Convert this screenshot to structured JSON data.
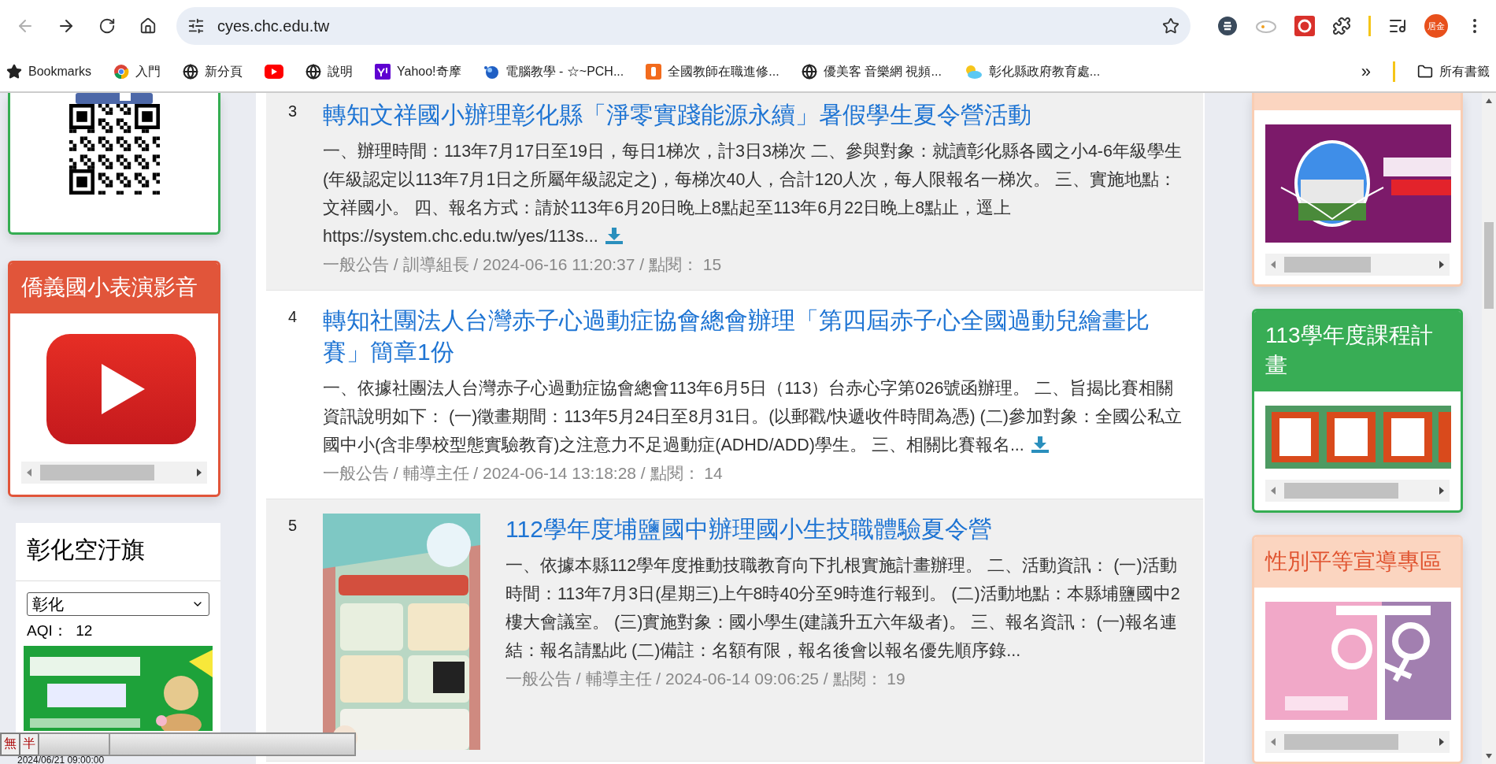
{
  "browser": {
    "address": "cyes.chc.edu.tw",
    "back_disabled": true,
    "avatar": "居金",
    "bookmarks": [
      {
        "kind": "star",
        "label": "Bookmarks"
      },
      {
        "kind": "chrome",
        "label": "入門"
      },
      {
        "kind": "globe",
        "label": "新分頁"
      },
      {
        "kind": "youtube"
      },
      {
        "kind": "globe",
        "label": "說明"
      },
      {
        "kind": "yahoo",
        "label": "Yahoo!奇摩"
      },
      {
        "kind": "orb",
        "label": "電腦教學 - ☆~PCH..."
      },
      {
        "kind": "app",
        "label": "全國教師在職進修..."
      },
      {
        "kind": "globe",
        "label": "優美客 音樂網 視頻..."
      },
      {
        "kind": "weather",
        "label": "彰化縣政府教育處..."
      }
    ],
    "overflow": "»",
    "all_bookmarks": "所有書籤"
  },
  "left": {
    "video_card": {
      "title": "僑義國小表演影音"
    },
    "air_card": {
      "title": "彰化空汙旗",
      "select_value": "彰化",
      "aqi_label": "AQI：",
      "aqi_value": "12"
    }
  },
  "notices": [
    {
      "kind": "text",
      "number": "3",
      "title": "轉知文祥國小辦理彰化縣「淨零實踐能源永續」暑假學生夏令營活動",
      "body": "一、辦理時間：113年7月17日至19日，每日1梯次，計3日3梯次 二、參與對象：就讀彰化縣各國之小4-6年級學生(年級認定以113年7月1日之所屬年級認定之)，每梯次40人，合計120人次，每人限報名一梯次。 三、實施地點：文祥國小。 四、報名方式：請於113年6月20日晚上8點起至113年6月22日晚上8點止，逕上https://system.chc.edu.tw/yes/113s...",
      "download": true,
      "meta": "一般公告 / 訓導組長 / 2024-06-16 11:20:37 / 點閱： 15"
    },
    {
      "kind": "text",
      "number": "4",
      "title": "轉知社團法人台灣赤子心過動症協會總會辦理「第四屆赤子心全國過動兒繪畫比賽」簡章1份",
      "body": "一、依據社團法人台灣赤子心過動症協會總會113年6月5日（113）台赤心字第026號函辦理。 二、旨揭比賽相關資訊說明如下： (一)徵畫期間：113年5月24日至8月31日。(以郵戳/快遞收件時間為憑) (二)參加對象：全國公私立國中小(含非學校型態實驗教育)之注意力不足過動症(ADHD/ADD)學生。 三、相關比賽報名...",
      "download": true,
      "meta": "一般公告 / 輔導主任 / 2024-06-14 13:18:28 / 點閱： 14"
    },
    {
      "kind": "picture",
      "number": "5",
      "title": "112學年度埔鹽國中辦理國小生技職體驗夏令營",
      "body": "一、依據本縣112學年度推動技職教育向下扎根實施計畫辦理。 二、活動資訊： (一)活動時間：113年7月3日(星期三)上午8時40分至9時進行報到。 (二)活動地點：本縣埔鹽國中2樓大會議室。 (三)實施對象：國小學生(建議升五六年級者)。 三、報名資訊： (一)報名連結：報名請點此 (二)備註：名額有限，報名後會以報名優先順序錄...",
      "download": false,
      "meta": "一般公告 / 輔導主任 / 2024-06-14 09:06:25 / 點閱： 19"
    }
  ],
  "right": [
    {
      "kind": "peach"
    },
    {
      "kind": "green",
      "title": "113學年度課程計畫"
    },
    {
      "kind": "peach",
      "title": "性別平等宣導專區"
    }
  ],
  "ime": {
    "mode": "無",
    "width": "半"
  },
  "clock": "2024/06/21 09:00:00"
}
